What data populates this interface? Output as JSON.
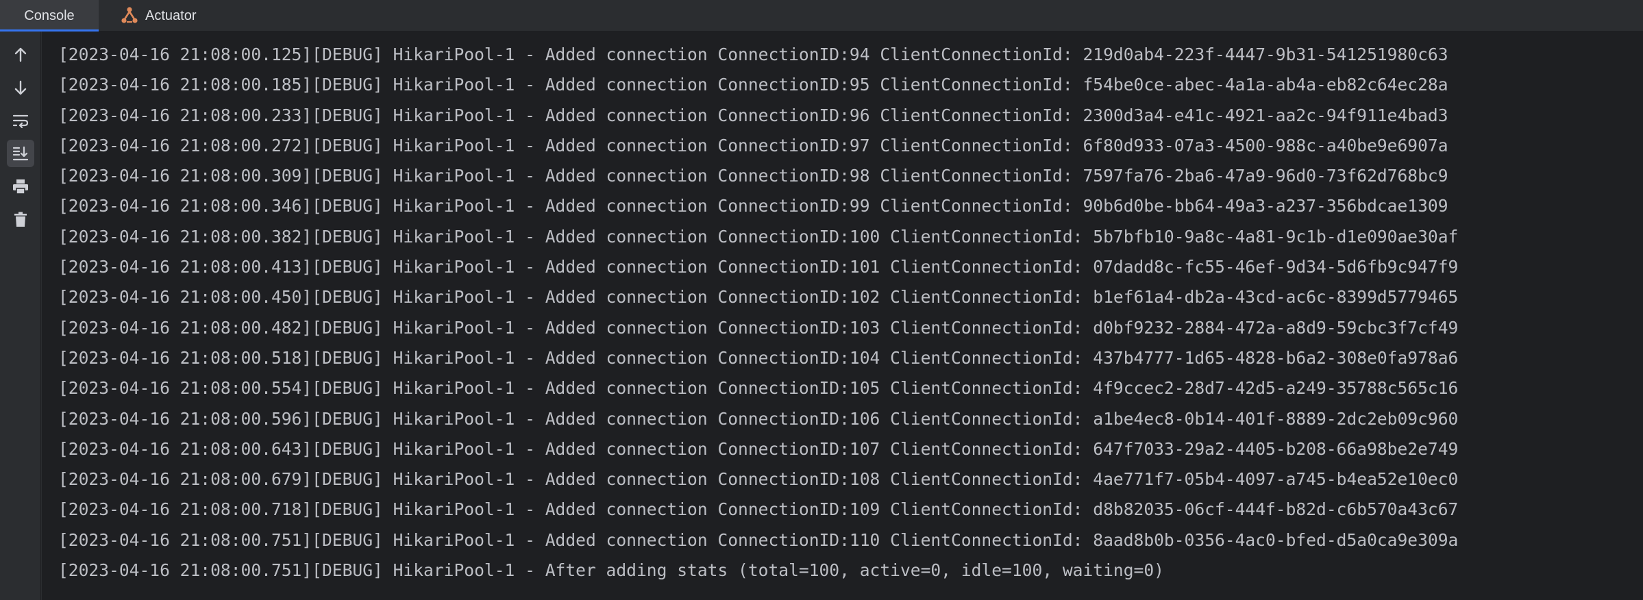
{
  "tabs": {
    "console_label": "Console",
    "actuator_label": "Actuator"
  },
  "icons": {
    "scroll_up": "arrow-up-icon",
    "scroll_down": "arrow-down-icon",
    "soft_wrap": "soft-wrap-icon",
    "scroll_to_end": "scroll-to-end-icon",
    "print": "print-icon",
    "clear": "trash-icon",
    "actuator": "actuator-icon"
  },
  "colors": {
    "tab_active_underline": "#3574f0",
    "console_text": "#bcbec4",
    "console_bg": "#1e1f22",
    "actuator_icon": "#e08a5a"
  },
  "console": {
    "lines": [
      "[2023-04-16 21:08:00.125][DEBUG] HikariPool-1 - Added connection ConnectionID:94 ClientConnectionId: 219d0ab4-223f-4447-9b31-541251980c63",
      "[2023-04-16 21:08:00.185][DEBUG] HikariPool-1 - Added connection ConnectionID:95 ClientConnectionId: f54be0ce-abec-4a1a-ab4a-eb82c64ec28a",
      "[2023-04-16 21:08:00.233][DEBUG] HikariPool-1 - Added connection ConnectionID:96 ClientConnectionId: 2300d3a4-e41c-4921-aa2c-94f911e4bad3",
      "[2023-04-16 21:08:00.272][DEBUG] HikariPool-1 - Added connection ConnectionID:97 ClientConnectionId: 6f80d933-07a3-4500-988c-a40be9e6907a",
      "[2023-04-16 21:08:00.309][DEBUG] HikariPool-1 - Added connection ConnectionID:98 ClientConnectionId: 7597fa76-2ba6-47a9-96d0-73f62d768bc9",
      "[2023-04-16 21:08:00.346][DEBUG] HikariPool-1 - Added connection ConnectionID:99 ClientConnectionId: 90b6d0be-bb64-49a3-a237-356bdcae1309",
      "[2023-04-16 21:08:00.382][DEBUG] HikariPool-1 - Added connection ConnectionID:100 ClientConnectionId: 5b7bfb10-9a8c-4a81-9c1b-d1e090ae30af",
      "[2023-04-16 21:08:00.413][DEBUG] HikariPool-1 - Added connection ConnectionID:101 ClientConnectionId: 07dadd8c-fc55-46ef-9d34-5d6fb9c947f9",
      "[2023-04-16 21:08:00.450][DEBUG] HikariPool-1 - Added connection ConnectionID:102 ClientConnectionId: b1ef61a4-db2a-43cd-ac6c-8399d5779465",
      "[2023-04-16 21:08:00.482][DEBUG] HikariPool-1 - Added connection ConnectionID:103 ClientConnectionId: d0bf9232-2884-472a-a8d9-59cbc3f7cf49",
      "[2023-04-16 21:08:00.518][DEBUG] HikariPool-1 - Added connection ConnectionID:104 ClientConnectionId: 437b4777-1d65-4828-b6a2-308e0fa978a6",
      "[2023-04-16 21:08:00.554][DEBUG] HikariPool-1 - Added connection ConnectionID:105 ClientConnectionId: 4f9ccec2-28d7-42d5-a249-35788c565c16",
      "[2023-04-16 21:08:00.596][DEBUG] HikariPool-1 - Added connection ConnectionID:106 ClientConnectionId: a1be4ec8-0b14-401f-8889-2dc2eb09c960",
      "[2023-04-16 21:08:00.643][DEBUG] HikariPool-1 - Added connection ConnectionID:107 ClientConnectionId: 647f7033-29a2-4405-b208-66a98be2e749",
      "[2023-04-16 21:08:00.679][DEBUG] HikariPool-1 - Added connection ConnectionID:108 ClientConnectionId: 4ae771f7-05b4-4097-a745-b4ea52e10ec0",
      "[2023-04-16 21:08:00.718][DEBUG] HikariPool-1 - Added connection ConnectionID:109 ClientConnectionId: d8b82035-06cf-444f-b82d-c6b570a43c67",
      "[2023-04-16 21:08:00.751][DEBUG] HikariPool-1 - Added connection ConnectionID:110 ClientConnectionId: 8aad8b0b-0356-4ac0-bfed-d5a0ca9e309a",
      "[2023-04-16 21:08:00.751][DEBUG] HikariPool-1 - After adding stats (total=100, active=0, idle=100, waiting=0)"
    ]
  }
}
